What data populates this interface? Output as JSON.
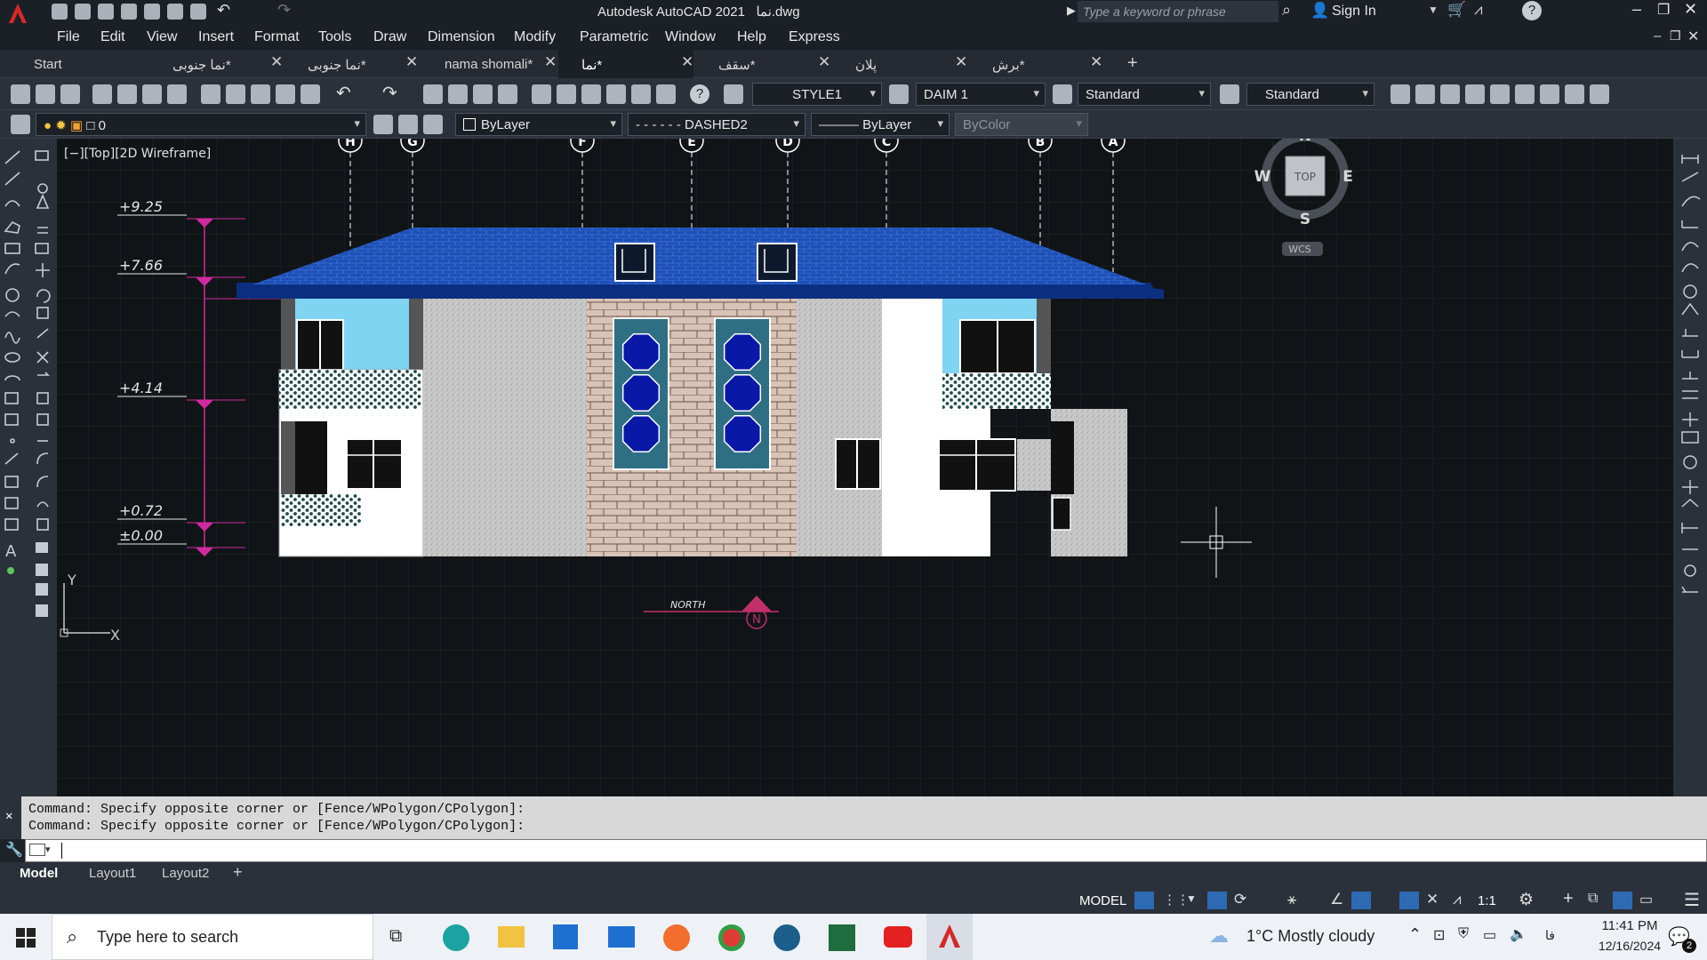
{
  "title": {
    "app": "Autodesk AutoCAD 2021",
    "file": "نما.dwg",
    "search_placeholder": "Type a keyword or phrase",
    "signin": "Sign In"
  },
  "menu": [
    "File",
    "Edit",
    "View",
    "Insert",
    "Format",
    "Tools",
    "Draw",
    "Dimension",
    "Modify",
    "Parametric",
    "Window",
    "Help",
    "Express"
  ],
  "tabs": [
    {
      "label": "Start",
      "closable": false,
      "active": false
    },
    {
      "label": "نما جنوبی*",
      "closable": true,
      "active": false
    },
    {
      "label": "نما جنوبی*",
      "closable": true,
      "active": false
    },
    {
      "label": "nama shomali*",
      "closable": true,
      "active": false
    },
    {
      "label": "نما*",
      "closable": true,
      "active": true
    },
    {
      "label": "سقف*",
      "closable": true,
      "active": false
    },
    {
      "label": "پلان",
      "closable": true,
      "active": false
    },
    {
      "label": "برش*",
      "closable": true,
      "active": false
    }
  ],
  "toolbar": {
    "text_style": "STYLE1",
    "dim_style": "DAIM 1",
    "table_style": "Standard",
    "mleader_style": "Standard"
  },
  "properties": {
    "layer": "0",
    "color": "ByLayer",
    "linetype": "DASHED2",
    "lineweight": "ByLayer",
    "plotstyle": "ByColor"
  },
  "viewport": {
    "label": "[−][Top][2D Wireframe]"
  },
  "viewcube": {
    "n": "N",
    "s": "S",
    "e": "E",
    "w": "W",
    "top": "TOP",
    "wcs": "WCS"
  },
  "gridlines": [
    "H",
    "G",
    "F",
    "E",
    "D",
    "C",
    "B",
    "A"
  ],
  "levels": [
    "+9.25",
    "+7.66",
    "+4.14",
    "+0.72",
    "±0.00"
  ],
  "north_label": "N",
  "north_text": "NORTH",
  "ucs": {
    "x": "X",
    "y": "Y"
  },
  "command": {
    "history": [
      "Command: Specify opposite corner or [Fence/WPolygon/CPolygon]:",
      "Command: Specify opposite corner or [Fence/WPolygon/CPolygon]:"
    ]
  },
  "layout_tabs": [
    "Model",
    "Layout1",
    "Layout2"
  ],
  "status": {
    "mode": "MODEL",
    "scale": "1:1"
  },
  "taskbar": {
    "search_placeholder": "Type here to search",
    "weather": "1°C  Mostly cloudy",
    "time": "11:41 PM",
    "date": "12/16/2024",
    "lang": "فا",
    "notifications": "2"
  },
  "colors": {
    "accent_red": "#d62828",
    "roof": "#1e4fb7",
    "cmd_bg": "#d8d8d8",
    "canvas_bg": "#111417"
  }
}
